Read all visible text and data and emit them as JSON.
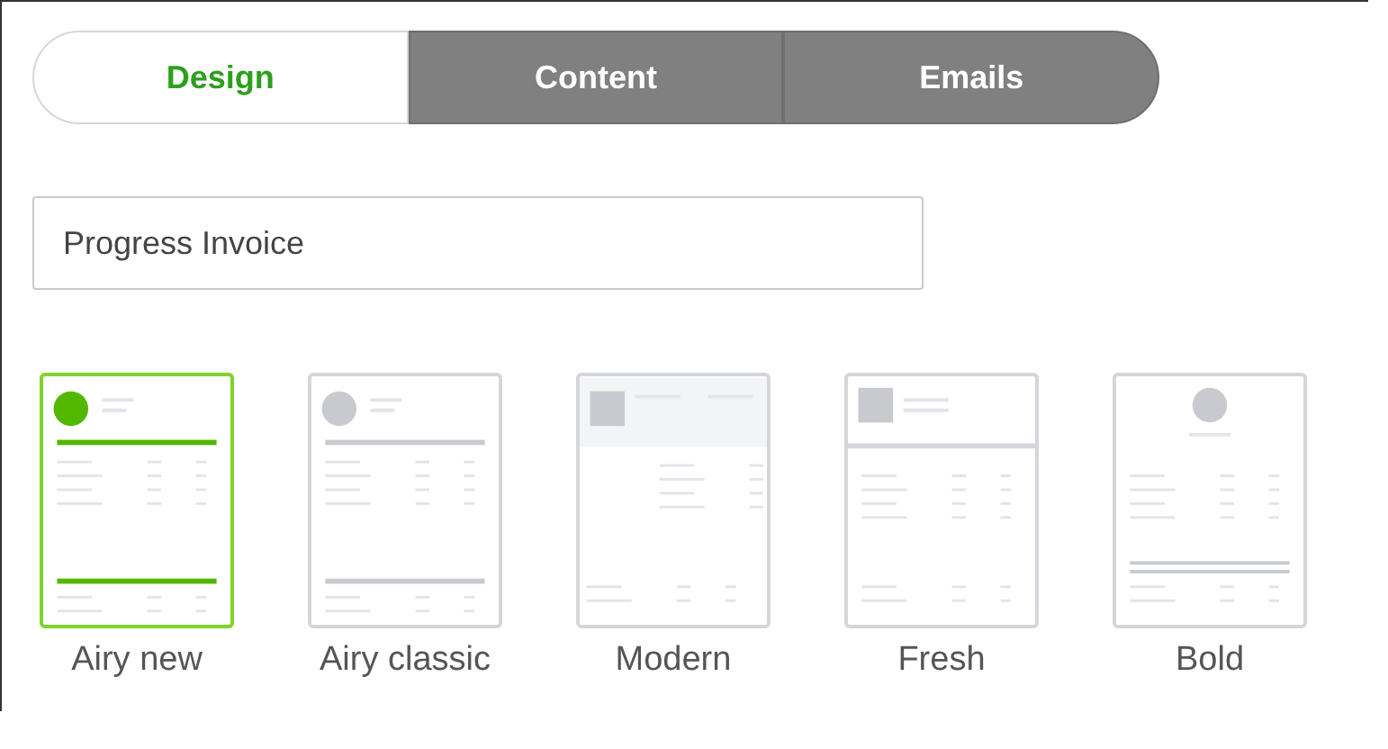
{
  "tabs": [
    {
      "label": "Design",
      "selected": true
    },
    {
      "label": "Content",
      "selected": false
    },
    {
      "label": "Emails",
      "selected": false
    }
  ],
  "template_name": {
    "value": "Progress Invoice"
  },
  "templates": [
    {
      "name": "Airy new",
      "kind": "airy",
      "selected": true
    },
    {
      "name": "Airy classic",
      "kind": "airy",
      "selected": false
    },
    {
      "name": "Modern",
      "kind": "modern",
      "selected": false
    },
    {
      "name": "Fresh",
      "kind": "fresh",
      "selected": false
    },
    {
      "name": "Bold",
      "kind": "bold",
      "selected": false
    }
  ]
}
